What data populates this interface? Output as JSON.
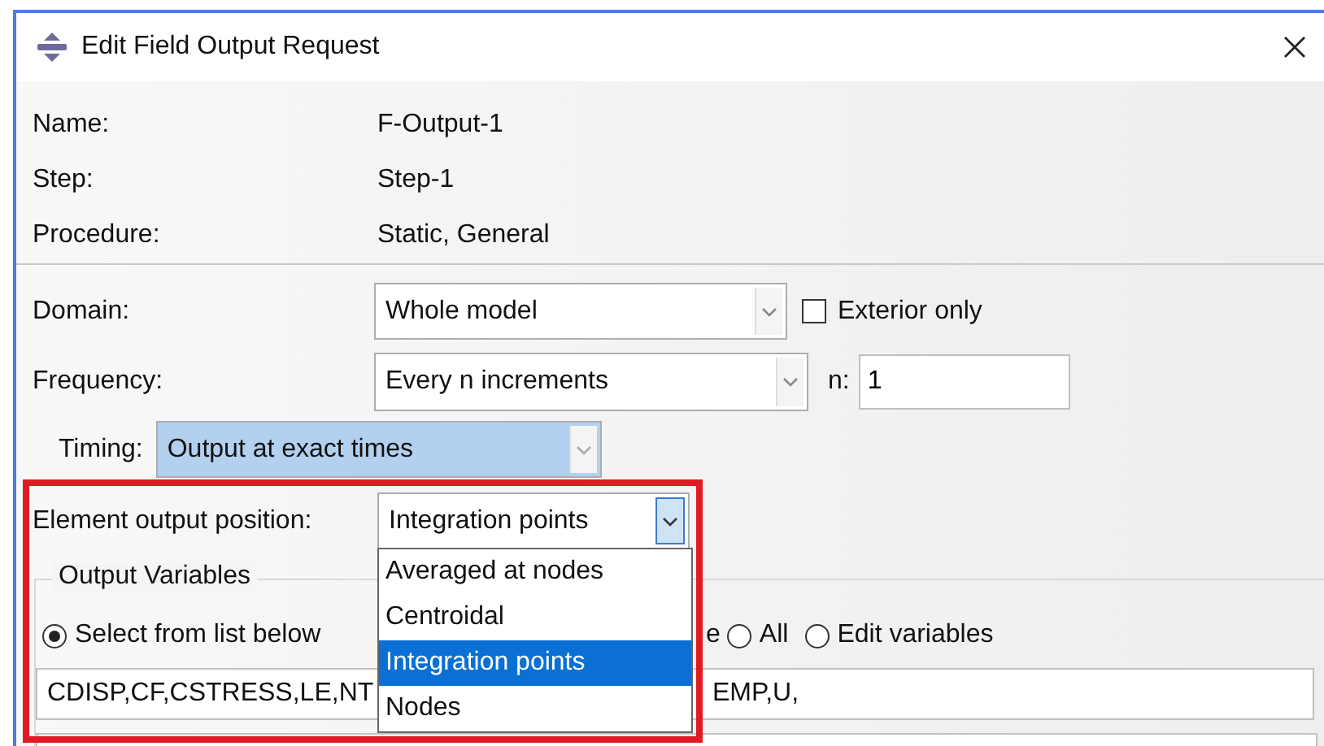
{
  "window": {
    "title": "Edit Field Output Request"
  },
  "info": [
    {
      "label": "Name:",
      "value": "F-Output-1"
    },
    {
      "label": "Step:",
      "value": "Step-1"
    },
    {
      "label": "Procedure:",
      "value": "Static, General"
    }
  ],
  "domain": {
    "label": "Domain:",
    "value": "Whole model",
    "exterior_only": {
      "label": "Exterior only",
      "checked": false
    }
  },
  "frequency": {
    "label": "Frequency:",
    "value": "Every n increments",
    "n_label": "n:",
    "n_value": "1"
  },
  "timing": {
    "label": "Timing:",
    "value": "Output at exact times",
    "highlighted": true
  },
  "element_output_position": {
    "label": "Element output position:",
    "value": "Integration points",
    "expanded": true,
    "options": [
      {
        "label": "Averaged at nodes",
        "selected": false
      },
      {
        "label": "Centroidal",
        "selected": false
      },
      {
        "label": "Integration points",
        "selected": true
      },
      {
        "label": "Nodes",
        "selected": false
      }
    ]
  },
  "output_variables": {
    "title": "Output Variables",
    "modes": [
      {
        "label": "Select from list below",
        "selected": true
      },
      {
        "label": "All",
        "selected": false
      },
      {
        "label": "Edit variables",
        "selected": false
      }
    ],
    "covered_label_end": "e",
    "field_start": "CDISP,CF,CSTRESS,LE,NT",
    "field_end": "EMP,U,"
  }
}
